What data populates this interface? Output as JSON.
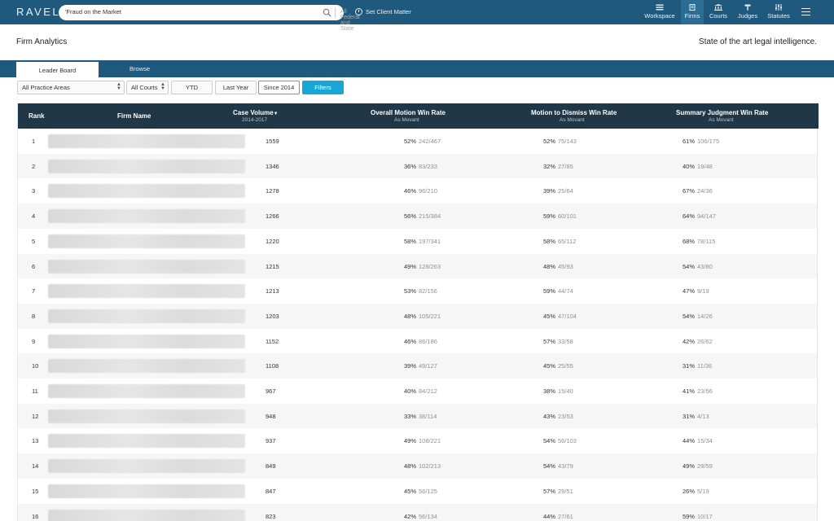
{
  "app": {
    "logo": "RAVEL",
    "search": {
      "value": "'Fraud on the Market",
      "scope": "All Federal and State"
    },
    "client_matter": "Set Client Matter",
    "nav": [
      {
        "label": "Workspace",
        "icon": "workspace-icon"
      },
      {
        "label": "Firms",
        "icon": "firms-icon",
        "active": true
      },
      {
        "label": "Courts",
        "icon": "courts-icon"
      },
      {
        "label": "Judges",
        "icon": "judges-icon"
      },
      {
        "label": "Statutes",
        "icon": "statutes-icon"
      }
    ]
  },
  "header": {
    "title": "Firm Analytics",
    "tagline": "State of the art legal intelligence."
  },
  "tabs": [
    {
      "label": "Leader Board",
      "active": true
    },
    {
      "label": "Browse"
    }
  ],
  "filters": {
    "practice_area": "All Practice Areas",
    "courts": "All Courts",
    "ytd": "YTD",
    "last_year": "Last Year",
    "since_2014": "Since 2014",
    "filters_button": "Filters"
  },
  "table": {
    "headers": {
      "rank": "Rank",
      "firm": "Firm Name",
      "volume": "Case Volume",
      "volume_sub": "2014-2017",
      "overall": "Overall Motion Win Rate",
      "overall_sub": "As Movant",
      "mtd": "Motion to Dismiss Win Rate",
      "mtd_sub": "As Movant",
      "sj": "Summary Judgment Win Rate",
      "sj_sub": "As Movant"
    },
    "rows": [
      {
        "rank": "1",
        "volume": "1559",
        "overall_pct": "52%",
        "overall_frac": "242/467",
        "mtd_pct": "52%",
        "mtd_frac": "75/143",
        "sj_pct": "61%",
        "sj_frac": "106/175"
      },
      {
        "rank": "2",
        "volume": "1346",
        "overall_pct": "36%",
        "overall_frac": "83/233",
        "mtd_pct": "32%",
        "mtd_frac": "27/85",
        "sj_pct": "40%",
        "sj_frac": "19/48"
      },
      {
        "rank": "3",
        "volume": "1278",
        "overall_pct": "46%",
        "overall_frac": "96/210",
        "mtd_pct": "39%",
        "mtd_frac": "25/64",
        "sj_pct": "67%",
        "sj_frac": "24/36"
      },
      {
        "rank": "4",
        "volume": "1266",
        "overall_pct": "56%",
        "overall_frac": "215/384",
        "mtd_pct": "59%",
        "mtd_frac": "60/101",
        "sj_pct": "64%",
        "sj_frac": "94/147"
      },
      {
        "rank": "5",
        "volume": "1220",
        "overall_pct": "58%",
        "overall_frac": "197/341",
        "mtd_pct": "58%",
        "mtd_frac": "65/112",
        "sj_pct": "68%",
        "sj_frac": "78/115"
      },
      {
        "rank": "6",
        "volume": "1215",
        "overall_pct": "49%",
        "overall_frac": "128/263",
        "mtd_pct": "48%",
        "mtd_frac": "45/93",
        "sj_pct": "54%",
        "sj_frac": "43/80"
      },
      {
        "rank": "7",
        "volume": "1213",
        "overall_pct": "53%",
        "overall_frac": "82/156",
        "mtd_pct": "59%",
        "mtd_frac": "44/74",
        "sj_pct": "47%",
        "sj_frac": "9/19"
      },
      {
        "rank": "8",
        "volume": "1203",
        "overall_pct": "48%",
        "overall_frac": "105/221",
        "mtd_pct": "45%",
        "mtd_frac": "47/104",
        "sj_pct": "54%",
        "sj_frac": "14/26"
      },
      {
        "rank": "9",
        "volume": "1152",
        "overall_pct": "46%",
        "overall_frac": "86/186",
        "mtd_pct": "57%",
        "mtd_frac": "33/58",
        "sj_pct": "42%",
        "sj_frac": "26/62"
      },
      {
        "rank": "10",
        "volume": "1108",
        "overall_pct": "39%",
        "overall_frac": "49/127",
        "mtd_pct": "45%",
        "mtd_frac": "25/55",
        "sj_pct": "31%",
        "sj_frac": "11/36"
      },
      {
        "rank": "11",
        "volume": "967",
        "overall_pct": "40%",
        "overall_frac": "84/212",
        "mtd_pct": "38%",
        "mtd_frac": "15/40",
        "sj_pct": "41%",
        "sj_frac": "23/56"
      },
      {
        "rank": "12",
        "volume": "948",
        "overall_pct": "33%",
        "overall_frac": "38/114",
        "mtd_pct": "43%",
        "mtd_frac": "23/53",
        "sj_pct": "31%",
        "sj_frac": "4/13"
      },
      {
        "rank": "13",
        "volume": "937",
        "overall_pct": "49%",
        "overall_frac": "108/221",
        "mtd_pct": "54%",
        "mtd_frac": "56/103",
        "sj_pct": "44%",
        "sj_frac": "15/34"
      },
      {
        "rank": "14",
        "volume": "849",
        "overall_pct": "48%",
        "overall_frac": "102/213",
        "mtd_pct": "54%",
        "mtd_frac": "43/79",
        "sj_pct": "49%",
        "sj_frac": "29/59"
      },
      {
        "rank": "15",
        "volume": "847",
        "overall_pct": "45%",
        "overall_frac": "56/125",
        "mtd_pct": "57%",
        "mtd_frac": "29/51",
        "sj_pct": "26%",
        "sj_frac": "5/19"
      },
      {
        "rank": "16",
        "volume": "823",
        "overall_pct": "42%",
        "overall_frac": "56/134",
        "mtd_pct": "44%",
        "mtd_frac": "27/61",
        "sj_pct": "59%",
        "sj_frac": "10/17"
      }
    ]
  },
  "colors": {
    "nav_bg": "#1f5a7e",
    "table_header": "#1f3747",
    "primary_button": "#17a6d6"
  }
}
